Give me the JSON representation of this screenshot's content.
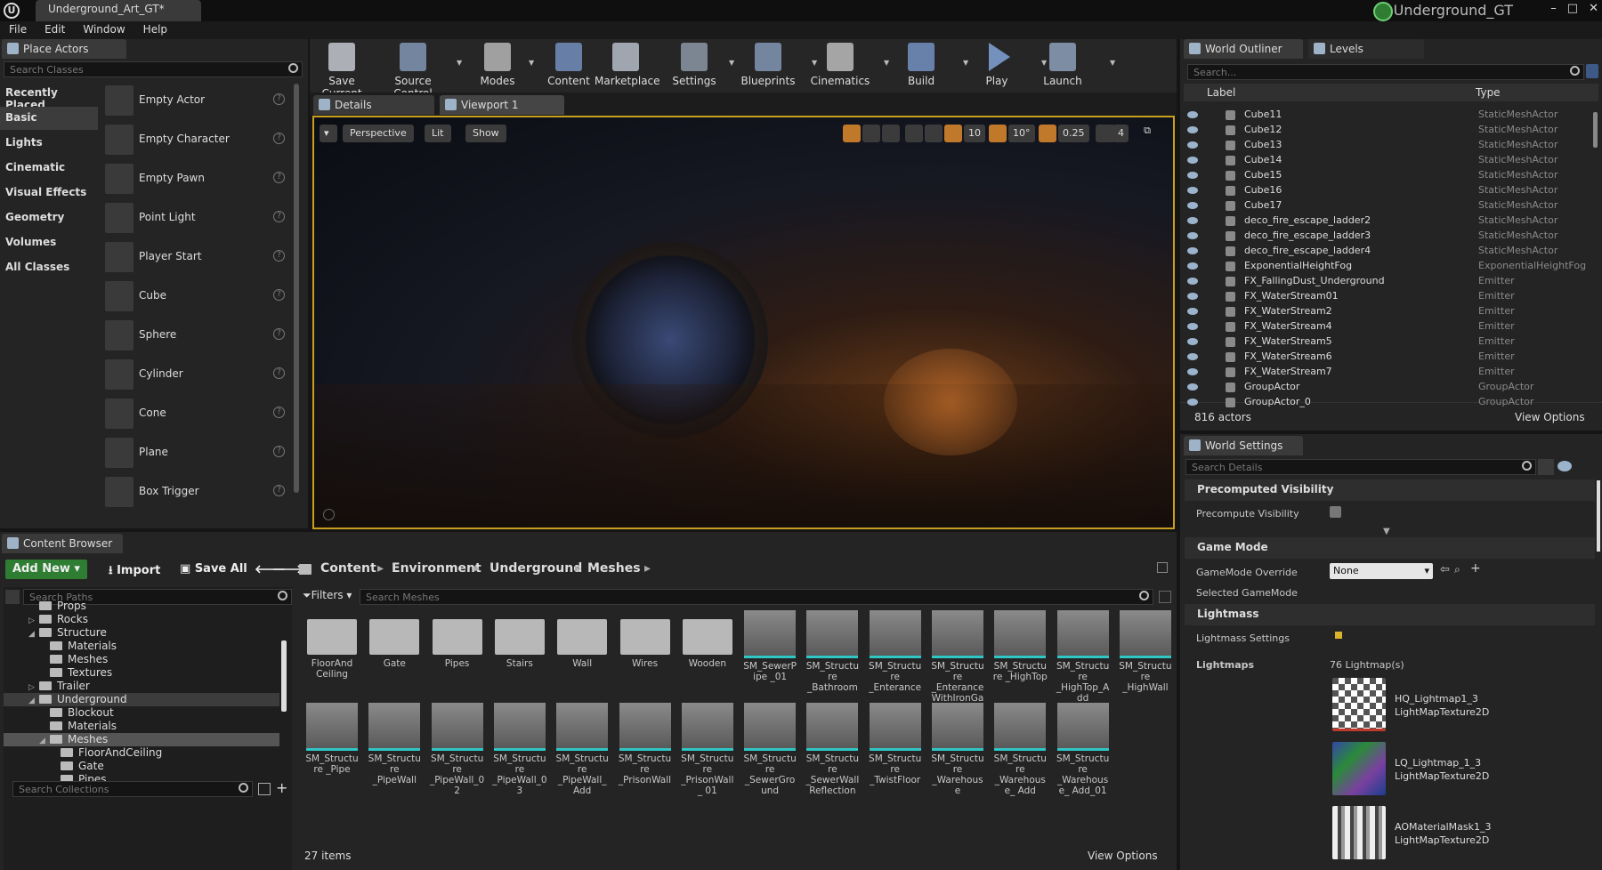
{
  "window": {
    "tab_title": "Underground_Art_GT*",
    "project_name": "Underground_GT",
    "controls": [
      "–",
      "□",
      "✕"
    ]
  },
  "menu": [
    "File",
    "Edit",
    "Window",
    "Help"
  ],
  "place_actors": {
    "tab": "Place Actors",
    "search_placeholder": "Search Classes",
    "categories": [
      "Recently Placed",
      "Basic",
      "Lights",
      "Cinematic",
      "Visual Effects",
      "Geometry",
      "Volumes",
      "All Classes"
    ],
    "selected_category": "Basic",
    "actors": [
      "Empty Actor",
      "Empty Character",
      "Empty Pawn",
      "Point Light",
      "Player Start",
      "Cube",
      "Sphere",
      "Cylinder",
      "Cone",
      "Plane",
      "Box Trigger"
    ]
  },
  "toolbar": [
    {
      "label": "Save Current",
      "icon": "save-icon",
      "color": "#d9dee6"
    },
    {
      "label": "Source Control",
      "icon": "source-control-icon",
      "color": "#8ea6c8"
    },
    {
      "label": "Modes",
      "icon": "modes-icon",
      "color": "#c9c9c9"
    },
    {
      "label": "Content",
      "icon": "content-icon",
      "color": "#7d9ed2"
    },
    {
      "label": "Marketplace",
      "icon": "marketplace-icon",
      "color": "#c9d2de"
    },
    {
      "label": "Settings",
      "icon": "settings-icon",
      "color": "#9aa7b8"
    },
    {
      "label": "Blueprints",
      "icon": "blueprints-icon",
      "color": "#8ea6c8"
    },
    {
      "label": "Cinematics",
      "icon": "cinematics-icon",
      "color": "#d0d0d0"
    },
    {
      "label": "Build",
      "icon": "build-icon",
      "color": "#7fa0d8"
    },
    {
      "label": "Play",
      "icon": "play-icon",
      "color": "#8fb6f0"
    },
    {
      "label": "Launch",
      "icon": "launch-icon",
      "color": "#9ab0cf"
    }
  ],
  "editor_tabs": {
    "details": "Details",
    "viewport": "Viewport 1"
  },
  "viewport": {
    "perspective": "Perspective",
    "lit": "Lit",
    "show": "Show",
    "grid_snap": "10",
    "rot_snap": "10°",
    "scale_snap": "0.25",
    "camera_speed": "4"
  },
  "outliner": {
    "tab": "World Outliner",
    "levels_tab": "Levels",
    "search_placeholder": "Search...",
    "col_label": "Label",
    "col_type": "Type",
    "rows": [
      {
        "label": "Cube11",
        "type": "StaticMeshActor"
      },
      {
        "label": "Cube12",
        "type": "StaticMeshActor"
      },
      {
        "label": "Cube13",
        "type": "StaticMeshActor"
      },
      {
        "label": "Cube14",
        "type": "StaticMeshActor"
      },
      {
        "label": "Cube15",
        "type": "StaticMeshActor"
      },
      {
        "label": "Cube16",
        "type": "StaticMeshActor"
      },
      {
        "label": "Cube17",
        "type": "StaticMeshActor"
      },
      {
        "label": "deco_fire_escape_ladder2",
        "type": "StaticMeshActor"
      },
      {
        "label": "deco_fire_escape_ladder3",
        "type": "StaticMeshActor"
      },
      {
        "label": "deco_fire_escape_ladder4",
        "type": "StaticMeshActor"
      },
      {
        "label": "ExponentialHeightFog",
        "type": "ExponentialHeightFog"
      },
      {
        "label": "FX_FallingDust_Underground",
        "type": "Emitter"
      },
      {
        "label": "FX_WaterStream01",
        "type": "Emitter"
      },
      {
        "label": "FX_WaterStream2",
        "type": "Emitter"
      },
      {
        "label": "FX_WaterStream4",
        "type": "Emitter"
      },
      {
        "label": "FX_WaterStream5",
        "type": "Emitter"
      },
      {
        "label": "FX_WaterStream6",
        "type": "Emitter"
      },
      {
        "label": "FX_WaterStream7",
        "type": "Emitter"
      },
      {
        "label": "GroupActor",
        "type": "GroupActor"
      },
      {
        "label": "GroupActor_0",
        "type": "GroupActor"
      }
    ],
    "count": "816 actors",
    "view_options": "View Options"
  },
  "world_settings": {
    "tab": "World Settings",
    "search_placeholder": "Search Details",
    "precomputed_visibility": "Precomputed Visibility",
    "precompute_visibility": "Precompute Visibility",
    "game_mode": "Game Mode",
    "gamemode_override": "GameMode Override",
    "gamemode_value": "None",
    "selected_gamemode": "Selected GameMode",
    "lightmass": "Lightmass",
    "lightmass_settings": "Lightmass Settings",
    "lightmaps": "Lightmaps",
    "lightmap_count": "76 Lightmap(s)",
    "lightmap_items": [
      {
        "name": "HQ_Lightmap1_3",
        "type": "LightMapTexture2D"
      },
      {
        "name": "LQ_Lightmap_1_3",
        "type": "LightMapTexture2D"
      },
      {
        "name": "AOMaterialMask1_3",
        "type": "LightMapTexture2D"
      }
    ]
  },
  "content_browser": {
    "tab": "Content Browser",
    "add_new": "Add New",
    "import": "Import",
    "save_all": "Save All",
    "path": [
      "Content",
      "Environment",
      "Underground",
      "Meshes"
    ],
    "search_paths_placeholder": "Search Paths",
    "filters": "Filters",
    "search_meshes_placeholder": "Search Meshes",
    "search_collections_placeholder": "Search Collections",
    "tree": [
      "Props",
      "Rocks",
      "Structure",
      "Materials",
      "Meshes",
      "Textures",
      "Trailer",
      "Underground",
      "Blockout",
      "Materials",
      "Meshes",
      "FloorAndCeiling",
      "Gate",
      "Pipes"
    ],
    "folders": [
      "FloorAnd Ceiling",
      "Gate",
      "Pipes",
      "Stairs",
      "Wall",
      "Wires",
      "Wooden"
    ],
    "assets_row1": [
      "SM_SewerPipe _01",
      "SM_Structure _Bathroom",
      "SM_Structure _Enterance",
      "SM_Structure _Enterance WithIronGate",
      "SM_Structure _HighTop",
      "SM_Structure _HighTop_Add",
      "SM_Structure _HighWall"
    ],
    "assets_row2": [
      "SM_Structure _Pipe",
      "SM_Structure _PipeWall",
      "SM_Structure _PipeWall_02",
      "SM_Structure _PipeWall_03",
      "SM_Structure _PipeWall_ Add",
      "SM_Structure _PrisonWall",
      "SM_Structure _PrisonWall_ 01",
      "SM_Structure _SewerGround",
      "SM_Structure _SewerWall Reflection",
      "SM_Structure _TwistFloor",
      "SM_Structure _Warehouse",
      "SM_Structure _Warehouse_ Add",
      "SM_Structure _Warehouse_ Add_01"
    ],
    "item_count": "27 items",
    "view_options": "View Options"
  },
  "colors": {
    "accent": "#c89f1e",
    "add_new": "#2e7d32",
    "selection": "#3c3c3c"
  }
}
